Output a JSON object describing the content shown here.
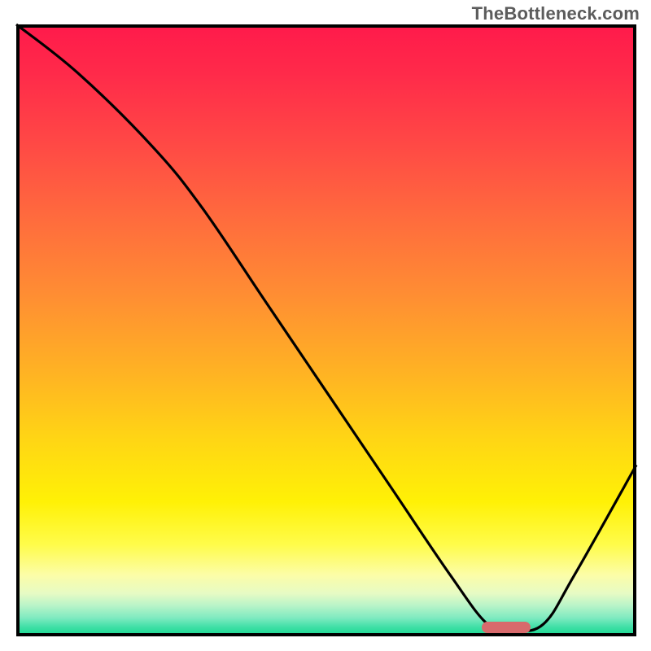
{
  "watermark": "TheBottleneck.com",
  "chart_data": {
    "type": "line",
    "title": "",
    "xlabel": "",
    "ylabel": "",
    "xlim": [
      0,
      100
    ],
    "ylim": [
      0,
      100
    ],
    "grid": false,
    "series": [
      {
        "name": "bottleneck-curve",
        "x": [
          0,
          10,
          22,
          30,
          40,
          50,
          60,
          70,
          76,
          80,
          85,
          90,
          100
        ],
        "y": [
          100,
          92,
          80,
          70,
          55,
          40,
          25,
          10,
          2,
          1,
          2,
          10,
          28
        ]
      }
    ],
    "marker": {
      "x": 79,
      "y": 1.5,
      "color": "#d86a6c"
    },
    "colors": {
      "gradient_top": "#ff1a4b",
      "gradient_bottom": "#16d88f",
      "curve": "#000000",
      "frame": "#000000"
    }
  }
}
